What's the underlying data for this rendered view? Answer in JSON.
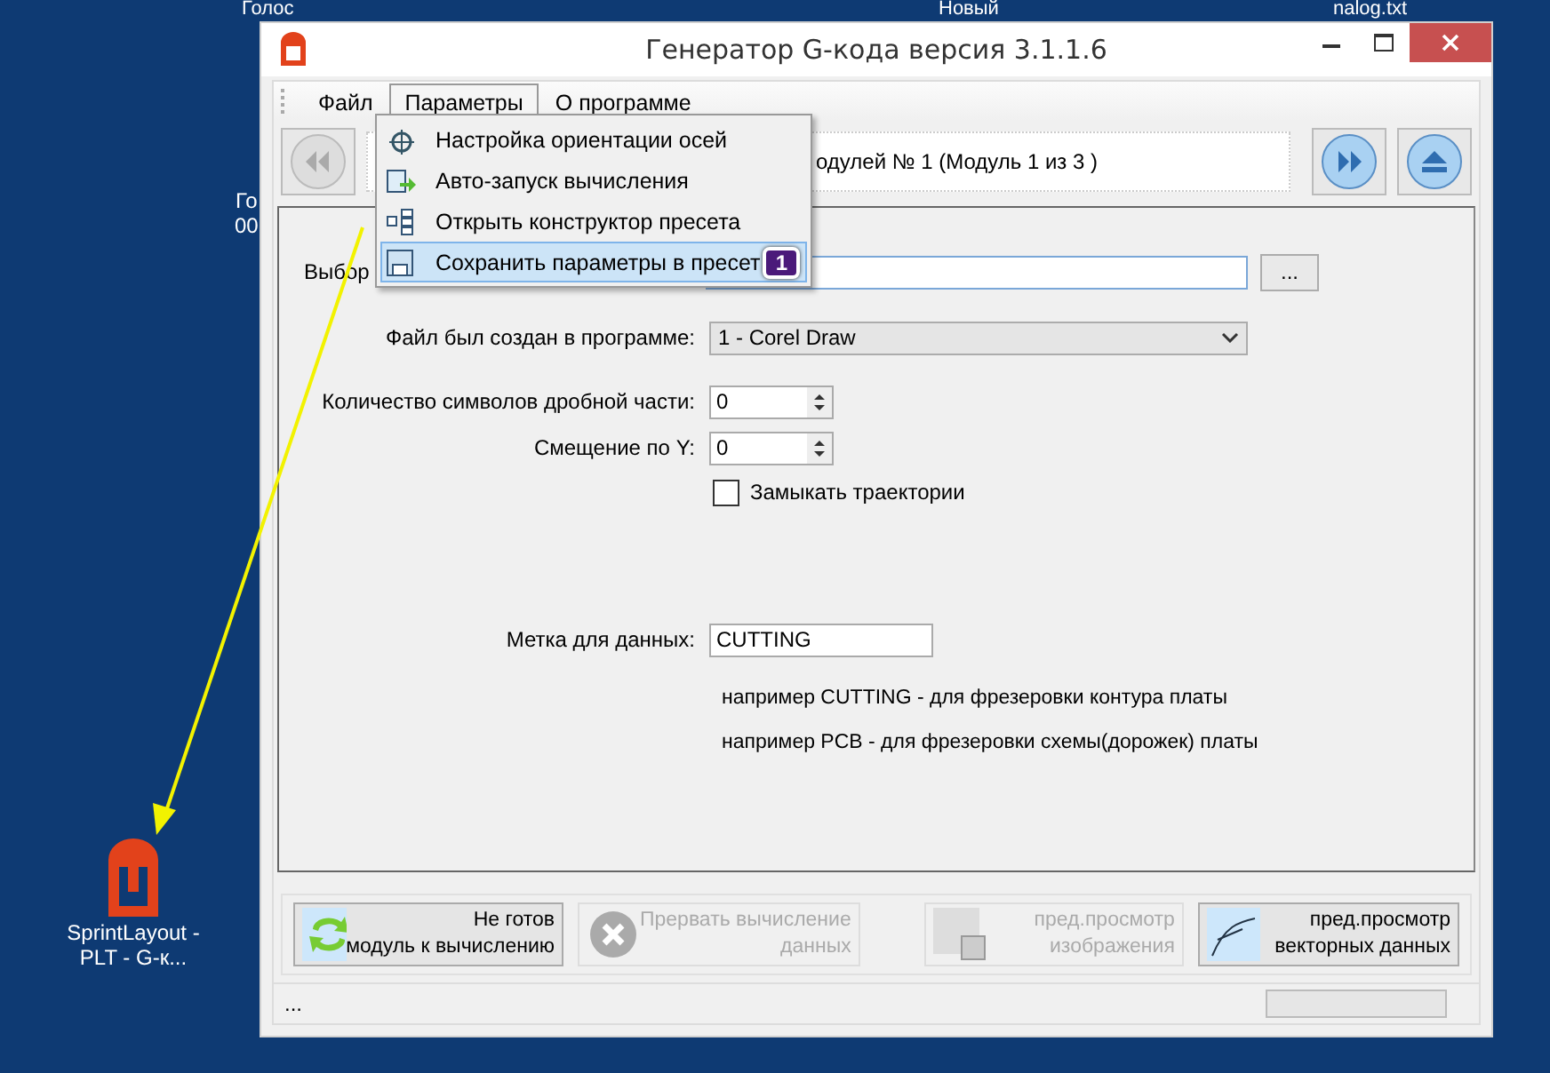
{
  "desktop_icons": [
    {
      "kind": "top",
      "label": "Голос"
    },
    {
      "kind": "top",
      "label": "Новый"
    },
    {
      "kind": "top",
      "label": "nalog.txt"
    },
    {
      "kind": "left",
      "label": "Го",
      "sublabel": "00"
    },
    {
      "kind": "app",
      "label": "SprintLayout - PLT - G-к..."
    }
  ],
  "window": {
    "title": "Генератор G-кода версия 3.1.1.6"
  },
  "menu_bar": [
    {
      "label": "Файл",
      "selected": false
    },
    {
      "label": "Параметры",
      "selected": true
    },
    {
      "label": "О программе",
      "selected": false
    }
  ],
  "dropdown": {
    "items": [
      {
        "kind": "axes",
        "label": "Настройка ориентации осей",
        "selected": false
      },
      {
        "kind": "autorun",
        "label": "Авто-запуск вычисления",
        "selected": false
      },
      {
        "kind": "constructor",
        "label": "Открыть конструктор пресета",
        "selected": false
      },
      {
        "kind": "save",
        "label": "Сохранить параметры в пресет",
        "selected": true,
        "badge": "1"
      }
    ]
  },
  "toolbar": {
    "module_text": "одулей № 1 (Модуль 1 из 3 )"
  },
  "form": {
    "file_label": "Выбор",
    "browse_button": "...",
    "program_label": "Файл был создан в программе:",
    "program_value": "1 - Corel Draw",
    "decimals_label": "Количество символов дробной части:",
    "decimals_value": "0",
    "offset_label": "Смещение по Y:",
    "offset_value": "0",
    "close_paths": {
      "label": "Замыкать траектории",
      "checked": false
    },
    "tag_label": "Метка для данных:",
    "tag_value": "CUTTING",
    "hints": [
      "например CUTTING - для фрезеровки контура платы",
      "например PCB - для фрезеровки схемы(дорожек) платы"
    ]
  },
  "actions": [
    {
      "kind": "refresh",
      "lines": [
        "Не готов",
        "модуль к вычислению"
      ],
      "disabled": false
    },
    {
      "kind": "stop",
      "lines": [
        "Прервать вычисление",
        "данных"
      ],
      "disabled": true
    },
    {
      "kind": "image",
      "lines": [
        "пред.просмотр",
        "изображения"
      ],
      "disabled": true
    },
    {
      "kind": "vector",
      "lines": [
        "пред.просмотр",
        "векторных данных"
      ],
      "disabled": false
    }
  ],
  "status_bar": {
    "text": "...",
    "progress": {
      "level": 0
    }
  }
}
